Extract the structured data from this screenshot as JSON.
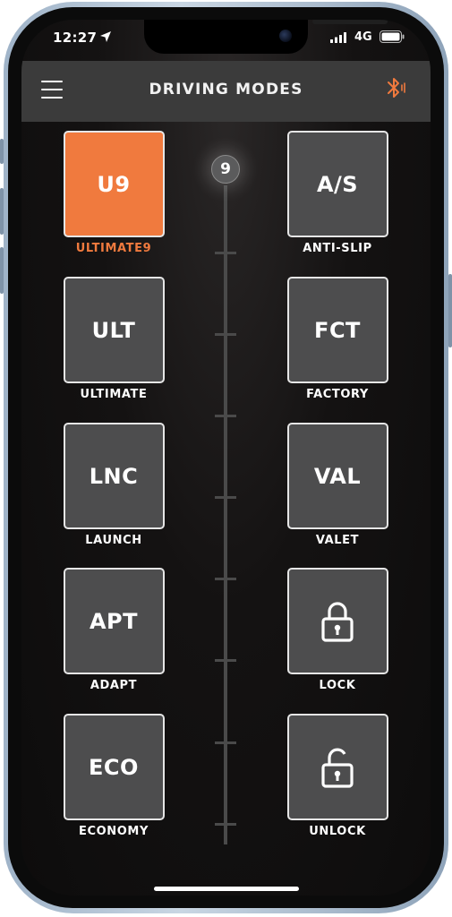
{
  "status_bar": {
    "time": "12:27",
    "network": "4G"
  },
  "header": {
    "title": "DRIVING MODES"
  },
  "slider": {
    "level": "9"
  },
  "modes_left": [
    {
      "code": "U9",
      "label": "ULTIMATE9",
      "active": true
    },
    {
      "code": "ULT",
      "label": "ULTIMATE"
    },
    {
      "code": "LNC",
      "label": "LAUNCH"
    },
    {
      "code": "APT",
      "label": "ADAPT"
    },
    {
      "code": "ECO",
      "label": "ECONOMY"
    }
  ],
  "modes_right": [
    {
      "code": "A/S",
      "label": "ANTI-SLIP"
    },
    {
      "code": "FCT",
      "label": "FACTORY"
    },
    {
      "code": "VAL",
      "label": "VALET"
    },
    {
      "icon": "lock-icon",
      "label": "LOCK"
    },
    {
      "icon": "unlock-icon",
      "label": "UNLOCK"
    }
  ],
  "colors": {
    "accent": "#f07a3e",
    "tile": "#4d4d4e",
    "header": "#3b3b3b"
  }
}
